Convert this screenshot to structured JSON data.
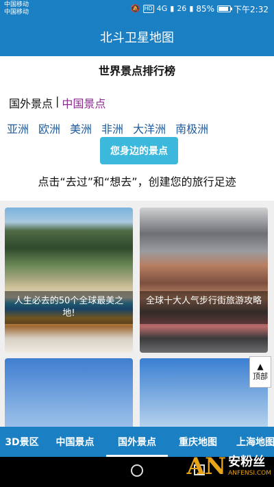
{
  "status_bar": {
    "carrier_1": "中国移动",
    "carrier_2": "中国移动",
    "hd_label": "HD",
    "network": "4G",
    "signal_label": "26",
    "battery": "85%",
    "battery_level": 0.85,
    "time": "下午2:32"
  },
  "app_bar": {
    "title": "北斗卫星地图"
  },
  "main": {
    "title": "世界景点排行榜",
    "tab_foreign": "国外景点",
    "separator": "|",
    "tab_china": "中国景点",
    "continents": [
      "亚洲",
      "欧洲",
      "美洲",
      "非洲",
      "大洋洲",
      "南极洲"
    ],
    "nearby_button": "您身边的景点",
    "slogan": "点击“去过”和“想去”，创建您的旅行足迹"
  },
  "cards": [
    {
      "caption": "人生必去的50个全球最美之地!"
    },
    {
      "caption": "全球十大人气步行街旅游攻略"
    }
  ],
  "top_button": {
    "arrow": "▲",
    "label": "顶部"
  },
  "bottom_nav": {
    "items": [
      "3D景区",
      "中国景点",
      "国外景点",
      "重庆地图",
      "上海地图"
    ],
    "active": "国外景点"
  },
  "watermark": {
    "logo": "AN",
    "cn": "安粉丝",
    "en": "ANFENSI.COM"
  },
  "colors": {
    "primary": "#1b7fc4",
    "accent_button": "#3bb8db",
    "active_tab": "#8a2a8e",
    "continent_link": "#1f5a9a"
  }
}
